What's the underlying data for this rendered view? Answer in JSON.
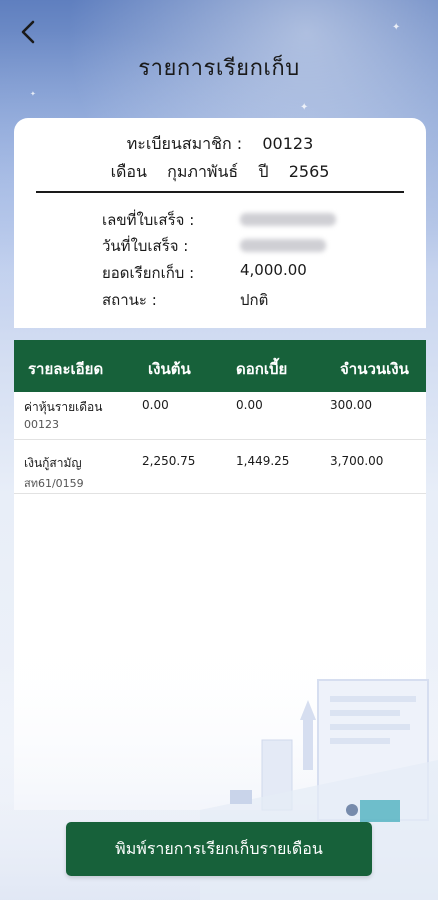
{
  "header": {
    "title": "รายการเรียกเก็บ",
    "back_icon": "chevron-left-icon"
  },
  "member": {
    "reg_label": "ทะเบียนสมาชิก :",
    "reg_value": "00123",
    "month_label": "เดือน",
    "month_value": "กุมภาพันธ์",
    "year_label": "ปี",
    "year_value": "2565"
  },
  "details": {
    "receipt_no_label": "เลขที่ใบเสร็จ :",
    "receipt_date_label": "วันที่ใบเสร็จ :",
    "amount_label": "ยอดเรียกเก็บ :",
    "amount_value": "4,000.00",
    "status_label": "สถานะ :",
    "status_value": "ปกติ"
  },
  "table": {
    "headers": [
      "รายละเอียด",
      "เงินต้น",
      "ดอกเบี้ย",
      "จำนวนเงิน"
    ],
    "rows": [
      {
        "title": "ค่าหุ้นรายเดือน",
        "sub": "00123",
        "principal": "0.00",
        "interest": "0.00",
        "amount": "300.00"
      },
      {
        "title": "เงินกู้สามัญ",
        "sub": "สท61/0159",
        "principal": "2,250.75",
        "interest": "1,449.25",
        "amount": "3,700.00"
      }
    ]
  },
  "footer": {
    "print_label": "พิมพ์รายการเรียกเก็บรายเดือน"
  },
  "colors": {
    "brand_green": "#17613a",
    "sky_top": "#5f7fbf",
    "background": "#f1f4fa"
  }
}
